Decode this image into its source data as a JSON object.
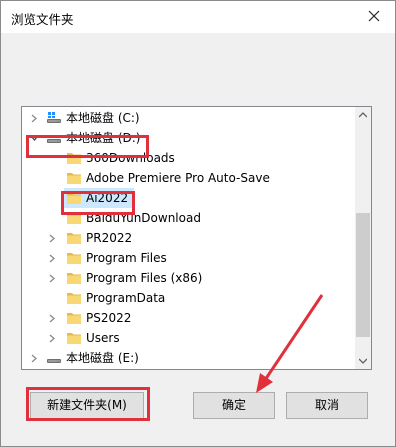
{
  "dialog": {
    "title": "浏览文件夹",
    "close_glyph": "✕",
    "buttons": {
      "new_folder": "新建文件夹(M)",
      "ok": "确定",
      "cancel": "取消"
    }
  },
  "tree": {
    "items": [
      {
        "label": "本地磁盘 (C:)",
        "icon": "drive-icon",
        "expander": "collapsed"
      },
      {
        "label": "本地磁盘 (D:)",
        "icon": "drive-icon",
        "expander": "expanded"
      },
      {
        "label": "360Downloads",
        "icon": "folder-icon",
        "expander": "none"
      },
      {
        "label": "Adobe Premiere Pro Auto-Save",
        "icon": "folder-icon",
        "expander": "none"
      },
      {
        "label": "Ai2022",
        "icon": "folder-icon",
        "expander": "none",
        "selected": true
      },
      {
        "label": "BaiduYunDownload",
        "icon": "folder-icon",
        "expander": "none"
      },
      {
        "label": "PR2022",
        "icon": "folder-icon",
        "expander": "collapsed"
      },
      {
        "label": "Program Files",
        "icon": "folder-icon",
        "expander": "collapsed"
      },
      {
        "label": "Program Files (x86)",
        "icon": "folder-icon",
        "expander": "collapsed"
      },
      {
        "label": "ProgramData",
        "icon": "folder-icon",
        "expander": "none"
      },
      {
        "label": "PS2022",
        "icon": "folder-icon",
        "expander": "collapsed"
      },
      {
        "label": "Users",
        "icon": "folder-icon",
        "expander": "collapsed"
      },
      {
        "label": "本地磁盘 (E:)",
        "icon": "drive-icon",
        "expander": "collapsed"
      }
    ]
  },
  "colors": {
    "highlight_box": "#e0303b",
    "selection": "#cce8ff",
    "folder": "#f8d775"
  }
}
